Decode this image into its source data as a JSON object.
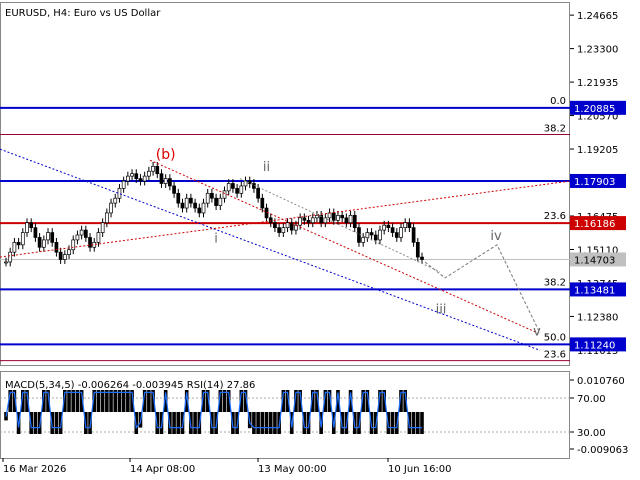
{
  "chart_data": {
    "type": "candlestick",
    "title": "EURUSD, H4:  Euro vs US Dollar",
    "price_axis": {
      "ylim": [
        1.104,
        1.252
      ],
      "ticks": [
        "1.24665",
        "1.23300",
        "1.21935",
        "1.20570",
        "1.19205",
        "1.17840",
        "1.16475",
        "1.15110",
        "1.13745",
        "1.12380",
        "1.11015"
      ]
    },
    "x_axis": {
      "ticks": [
        "16 Mar 2026",
        "14 Apr 08:00",
        "13 May 00:00",
        "10 Jun 16:00"
      ]
    },
    "levels": [
      {
        "value": 1.20885,
        "tag": "1.20885",
        "color": "#0000cc",
        "fib": "0.0"
      },
      {
        "value": 1.17903,
        "tag": "1.17903",
        "color": "#0000cc",
        "fib": ""
      },
      {
        "value": 1.16186,
        "tag": "1.16186",
        "color": "#cc0000",
        "fib": "23.6"
      },
      {
        "value": 1.13481,
        "tag": "1.13481",
        "color": "#0000cc",
        "fib": "38.2"
      },
      {
        "value": 1.1124,
        "tag": "1.11240",
        "color": "#0000cc",
        "fib": "50.0"
      }
    ],
    "fib_extra": [
      {
        "value": 1.198,
        "label": "38.2",
        "color": "#990033"
      },
      {
        "value": 1.1058,
        "label": "23.6",
        "color": "#990033"
      }
    ],
    "current": {
      "value": 1.14703,
      "tag": "1.14703"
    },
    "wave_labels": [
      {
        "text": "(b)",
        "color": "#dd0000",
        "price": 1.188,
        "bar": 38
      },
      {
        "text": "ii",
        "color": "#666666",
        "price": 1.183,
        "bar": 62
      },
      {
        "text": "i",
        "color": "#666666",
        "price": 1.154,
        "bar": 50
      },
      {
        "text": "iii",
        "color": "#666666",
        "price": 1.125,
        "bar": 110
      },
      {
        "text": "iv",
        "color": "#666666",
        "price": 1.155,
        "bar": 124
      },
      {
        "text": "v",
        "color": "#666666",
        "price": 1.116,
        "bar": 134
      }
    ],
    "price_series": [
      1.146,
      1.15,
      1.154,
      1.153,
      1.158,
      1.162,
      1.16,
      1.156,
      1.152,
      1.155,
      1.158,
      1.154,
      1.15,
      1.147,
      1.149,
      1.151,
      1.155,
      1.157,
      1.159,
      1.156,
      1.152,
      1.154,
      1.158,
      1.162,
      1.166,
      1.17,
      1.172,
      1.176,
      1.179,
      1.181,
      1.182,
      1.18,
      1.179,
      1.181,
      1.183,
      1.185,
      1.182,
      1.178,
      1.18,
      1.177,
      1.174,
      1.17,
      1.168,
      1.172,
      1.17,
      1.168,
      1.166,
      1.17,
      1.174,
      1.172,
      1.169,
      1.172,
      1.175,
      1.178,
      1.176,
      1.174,
      1.177,
      1.179,
      1.178,
      1.176,
      1.172,
      1.168,
      1.164,
      1.162,
      1.16,
      1.158,
      1.16,
      1.162,
      1.159,
      1.161,
      1.164,
      1.163,
      1.162,
      1.164,
      1.165,
      1.162,
      1.164,
      1.166,
      1.163,
      1.165,
      1.164,
      1.162,
      1.165,
      1.16,
      1.154,
      1.156,
      1.158,
      1.157,
      1.155,
      1.159,
      1.161,
      1.16,
      1.158,
      1.156,
      1.16,
      1.162,
      1.16,
      1.154,
      1.148,
      1.147
    ],
    "indicator": {
      "label": "MACD(5,34,5) -0.006264 -0.003945 RSI(14) 27.86",
      "ticks": [
        "0.010760",
        "70.00",
        "30.00",
        "-0.009063"
      ]
    }
  }
}
